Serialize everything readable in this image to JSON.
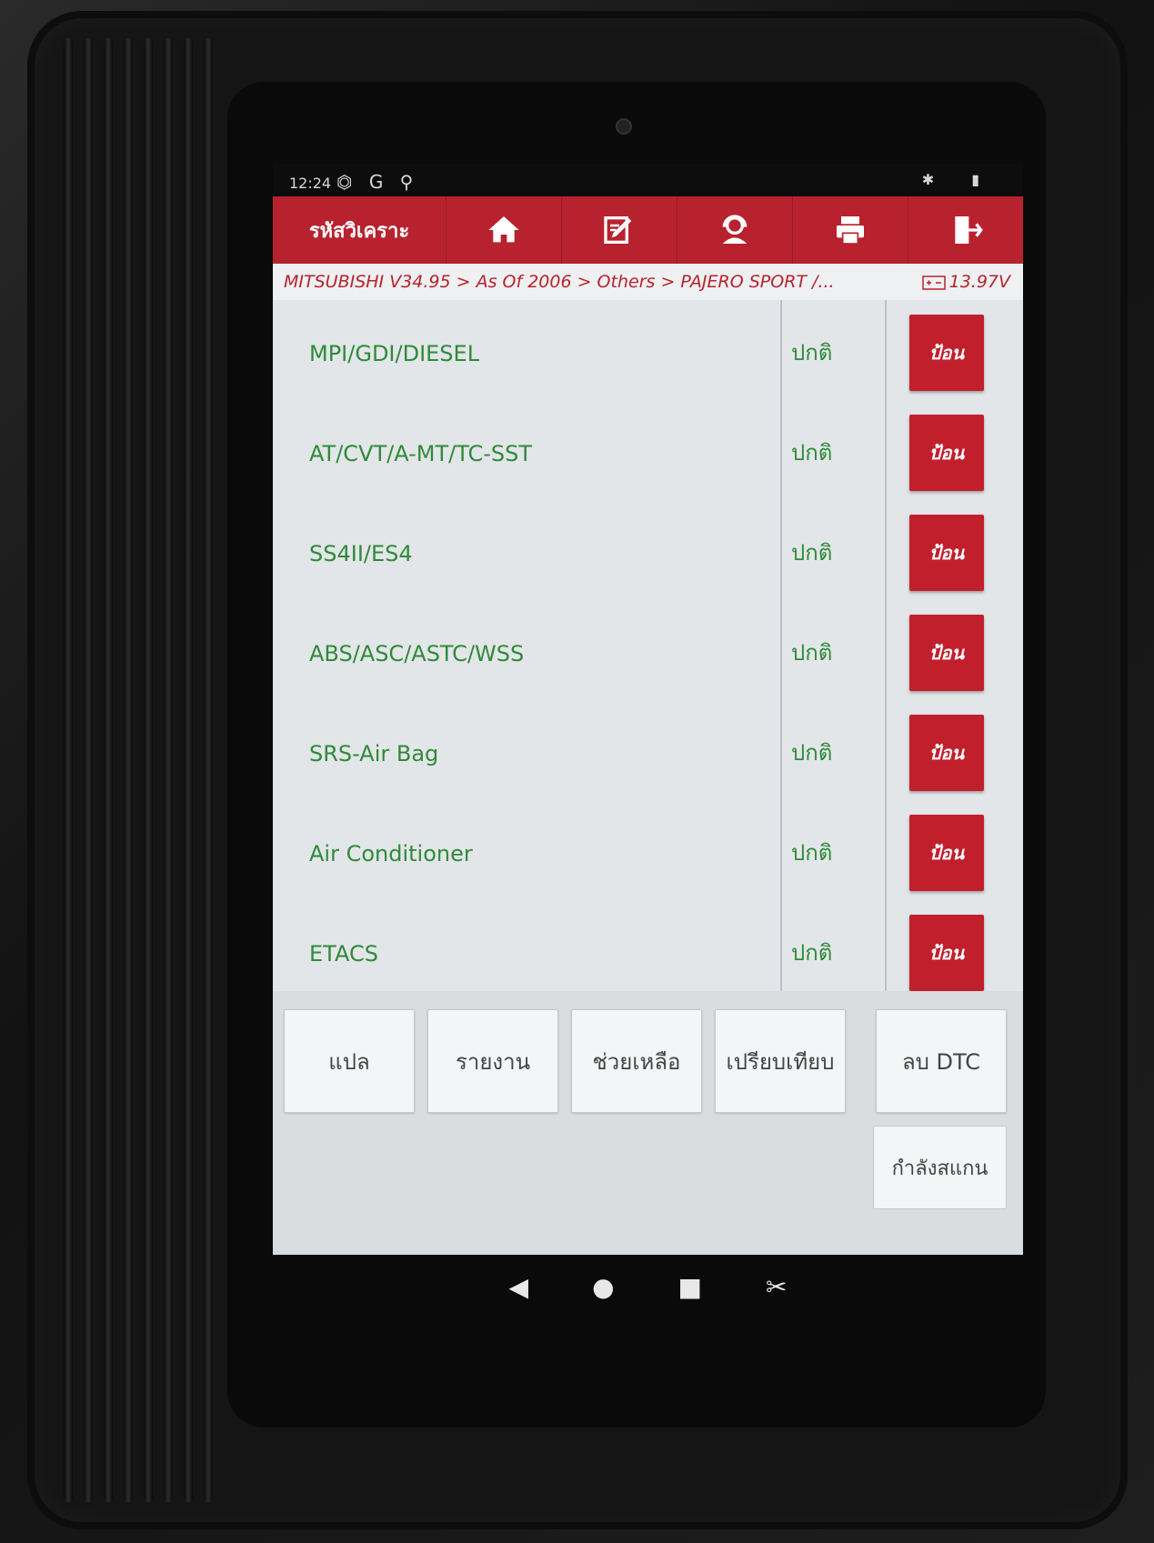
{
  "status_bar": {
    "time": "12:24",
    "left_icons": "⏣ G ⚲",
    "right_icons": "✱ ▮"
  },
  "toolbar": {
    "title": "รหัสวิเคราะ",
    "buttons": [
      "home-icon",
      "edit-icon",
      "support-icon",
      "print-icon",
      "exit-icon"
    ]
  },
  "breadcrumb": "MITSUBISHI V34.95 > As Of 2006 > Others > PAJERO SPORT /...",
  "voltage": "13.97V",
  "systems": [
    {
      "name": "MPI/GDI/DIESEL",
      "status": "ปกติ",
      "action": "ป้อน"
    },
    {
      "name": "AT/CVT/A-MT/TC-SST",
      "status": "ปกติ",
      "action": "ป้อน"
    },
    {
      "name": "SS4II/ES4",
      "status": "ปกติ",
      "action": "ป้อน"
    },
    {
      "name": "ABS/ASC/ASTC/WSS",
      "status": "ปกติ",
      "action": "ป้อน"
    },
    {
      "name": "SRS-Air Bag",
      "status": "ปกติ",
      "action": "ป้อน"
    },
    {
      "name": "Air Conditioner",
      "status": "ปกติ",
      "action": "ป้อน"
    },
    {
      "name": "ETACS",
      "status": "ปกติ",
      "action": "ป้อน"
    }
  ],
  "actions": {
    "translate": "แปล",
    "report": "รายงาน",
    "help": "ช่วยเหลือ",
    "compare": "เปรียบเทียบ",
    "clear_dtc": "ลบ DTC",
    "scanning": "กำลังสแกน"
  },
  "navbar": {
    "back": "◀",
    "home": "●",
    "recent": "■",
    "screenshot": "✂"
  },
  "colors": {
    "accent": "#b8222e",
    "status_green": "#2f8a3a"
  }
}
